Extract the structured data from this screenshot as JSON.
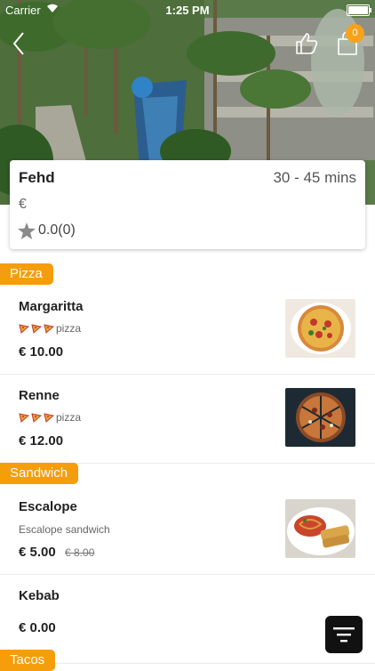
{
  "status_bar": {
    "carrier": "Carrier",
    "time": "1:25 PM"
  },
  "header": {
    "cart_count": "0",
    "icons": [
      "back-arrow-icon",
      "thumbs-up-icon",
      "shopping-bag-icon"
    ]
  },
  "restaurant": {
    "name": "Fehd",
    "eta": "30 - 45  mins",
    "currency": "€",
    "rating": "0.0(0)"
  },
  "categories": [
    {
      "label": "Pizza"
    },
    {
      "label": "Sandwich"
    },
    {
      "label": "Tacos"
    }
  ],
  "items": [
    {
      "name": "Margaritta",
      "desc": "pizza",
      "price": "€ 10.00"
    },
    {
      "name": "Renne",
      "desc": "pizza",
      "price": "€ 12.00"
    },
    {
      "name": "Escalope",
      "desc": "Escalope sandwich",
      "price": "€ 5.00",
      "old_price": "€ 8.00"
    },
    {
      "name": "Kebab",
      "price": "€ 0.00"
    }
  ],
  "colors": {
    "accent": "#f59d0b",
    "badge": "#f7a21b",
    "filter_button": "#111111"
  }
}
